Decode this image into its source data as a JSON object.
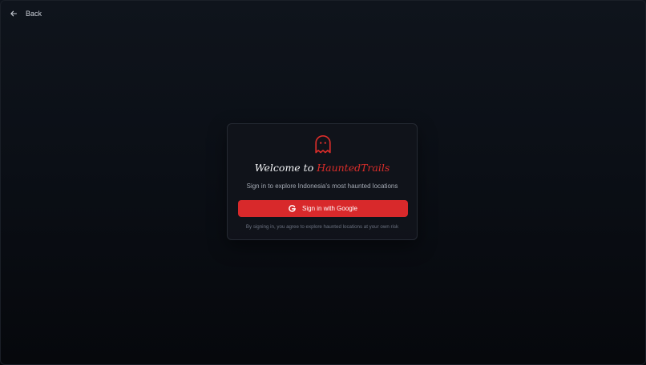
{
  "nav": {
    "back_label": "Back"
  },
  "login_card": {
    "icon": "ghost-icon",
    "title_prefix": "Welcome to",
    "title_brand": "HauntedTrails",
    "subtitle": "Sign in to explore Indonesia's most haunted locations",
    "button_label": "Sign in with Google",
    "button_icon": "google-icon",
    "terms": "By signing in, you agree to explore haunted locations at your own risk"
  },
  "colors": {
    "accent": "#d8292b",
    "background": "#0b0f16",
    "card": "#11141b"
  }
}
